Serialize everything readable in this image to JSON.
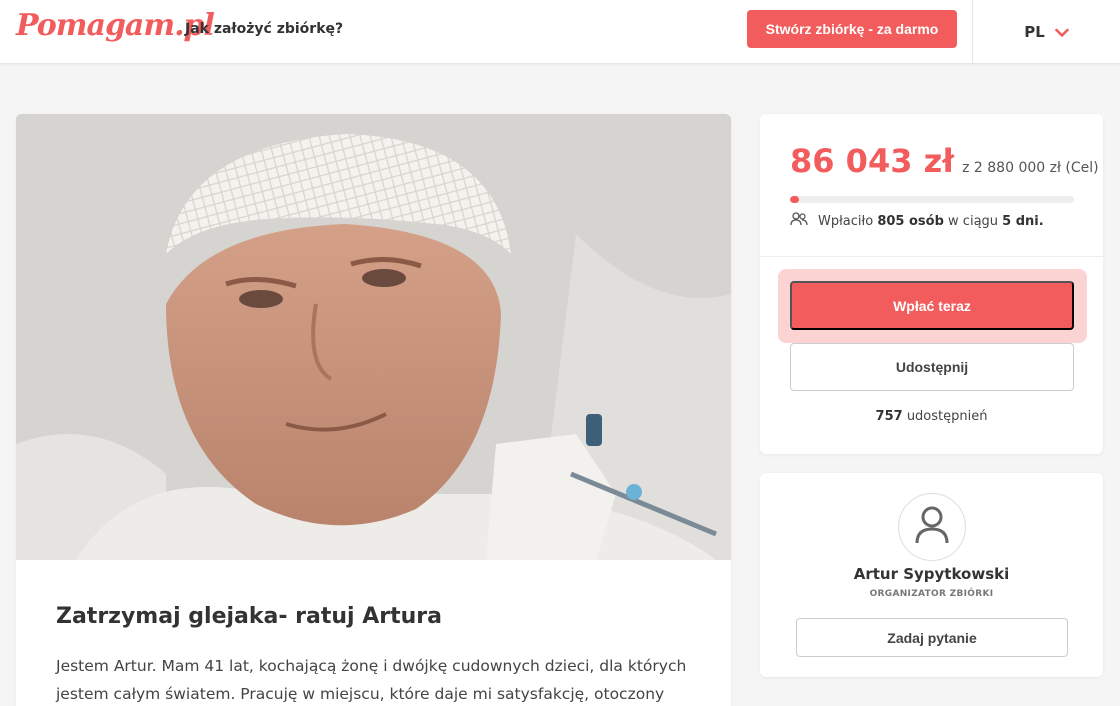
{
  "header": {
    "logo": "Pomagam.pl",
    "howto_link": "Jak założyć zbiórkę?",
    "create_button": "Stwórz zbiórkę - za darmo",
    "language": "PL"
  },
  "campaign": {
    "title": "Zatrzymaj glejaka- ratuj Artura",
    "description": "Jestem Artur. Mam 41 lat, kochającą żonę i dwójkę cudownych dzieci, dla których jestem całym światem. Pracuję w miejscu, które daje mi satysfakcję, otoczony ludźmi, na których"
  },
  "donation": {
    "raised": "86 043 zł",
    "goal_text": "z 2 880 000 zł (Cel)",
    "progress_fraction": 0.03,
    "donors_prefix": "Wpłaciło",
    "donors_count": "805 osób",
    "donors_mid": "w ciągu",
    "days": "5 dni.",
    "pay_button": "Wpłać teraz",
    "share_button": "Udostępnij",
    "shares_count": "757",
    "shares_label": "udostępnień"
  },
  "organizer": {
    "name": "Artur Sypytkowski",
    "role": "ORGANIZATOR ZBIÓRKI",
    "ask_button": "Zadaj pytanie"
  },
  "colors": {
    "accent": "#f25c5c",
    "background": "#f5f5f5"
  },
  "icons": {
    "language_toggle": "chevron-down-icon",
    "donors": "people-icon",
    "avatar": "user-icon"
  }
}
